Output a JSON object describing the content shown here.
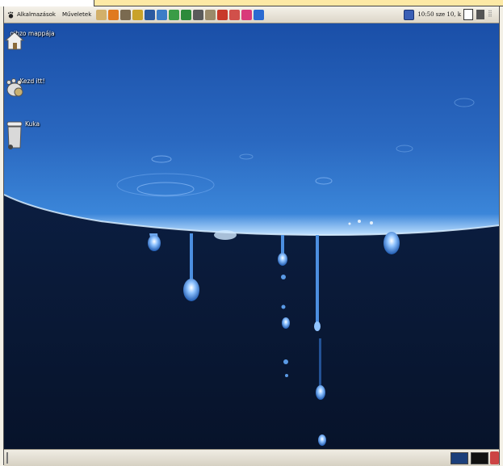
{
  "top_panel": {
    "applications_label": "Alkalmazások",
    "actions_label": "Műveletek",
    "launchers": [
      {
        "icon": "home-launcher-icon",
        "color": "#d2b06a"
      },
      {
        "icon": "web-browser-icon",
        "color": "#e07a1f"
      },
      {
        "icon": "gimp-icon",
        "color": "#7a6a50"
      },
      {
        "icon": "tools-icon",
        "color": "#c9a22a"
      },
      {
        "icon": "terminal-icon",
        "color": "#2c5aa0"
      },
      {
        "icon": "editor-icon",
        "color": "#3c7dc7"
      },
      {
        "icon": "spreadsheet-icon",
        "color": "#3a9c46"
      },
      {
        "icon": "shield-icon",
        "color": "#2d8a3a"
      },
      {
        "icon": "system-icon",
        "color": "#5a5a5a"
      },
      {
        "icon": "wrench-icon",
        "color": "#9a8a6a"
      },
      {
        "icon": "book-icon",
        "color": "#c83a2a"
      },
      {
        "icon": "gift-icon",
        "color": "#d1504a"
      },
      {
        "icon": "presentation-icon",
        "color": "#d93a7a"
      },
      {
        "icon": "bird-icon",
        "color": "#2a6ad1"
      }
    ],
    "clock": "10:50 sze 10, k"
  },
  "desktop_icons": [
    {
      "label": "gibzo mappája",
      "icon": "home-folder-icon"
    },
    {
      "label": "Kezd itt!",
      "icon": "start-here-icon"
    },
    {
      "label": "Kuka",
      "icon": "trash-icon"
    }
  ],
  "colors": {
    "wallpaper_dark": "#0b1832",
    "wallpaper_water": "#2e6fc4",
    "panel": "#e8e4d8"
  }
}
